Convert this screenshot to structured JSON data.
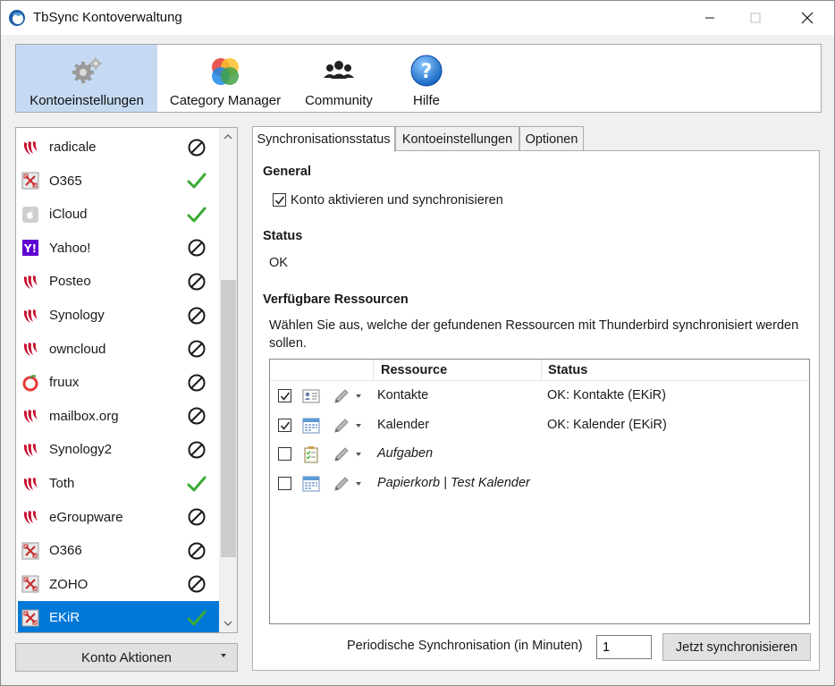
{
  "window": {
    "title": "TbSync Kontoverwaltung"
  },
  "toolbar": {
    "items": [
      {
        "label": "Kontoeinstellungen",
        "icon": "gears-icon",
        "active": true
      },
      {
        "label": "Category Manager",
        "icon": "color-circles-icon",
        "active": false
      },
      {
        "label": "Community",
        "icon": "people-icon",
        "active": false
      },
      {
        "label": "Hilfe",
        "icon": "help-icon",
        "active": false
      }
    ]
  },
  "accounts": {
    "items": [
      {
        "name": "radicale",
        "icon": "caldav-icon",
        "status": "disabled"
      },
      {
        "name": "O365",
        "icon": "eas-icon",
        "status": "ok"
      },
      {
        "name": "iCloud",
        "icon": "icloud-icon",
        "status": "ok"
      },
      {
        "name": "Yahoo!",
        "icon": "yahoo-icon",
        "status": "disabled"
      },
      {
        "name": "Posteo",
        "icon": "caldav-icon",
        "status": "disabled"
      },
      {
        "name": "Synology",
        "icon": "caldav-icon",
        "status": "disabled"
      },
      {
        "name": "owncloud",
        "icon": "caldav-icon",
        "status": "disabled"
      },
      {
        "name": "fruux",
        "icon": "fruux-icon",
        "status": "disabled"
      },
      {
        "name": "mailbox.org",
        "icon": "caldav-icon",
        "status": "disabled"
      },
      {
        "name": "Synology2",
        "icon": "caldav-icon",
        "status": "disabled"
      },
      {
        "name": "Toth",
        "icon": "caldav-icon",
        "status": "ok"
      },
      {
        "name": "eGroupware",
        "icon": "caldav-icon",
        "status": "disabled"
      },
      {
        "name": "O366",
        "icon": "eas-icon",
        "status": "disabled"
      },
      {
        "name": "ZOHO",
        "icon": "eas-icon",
        "status": "disabled"
      },
      {
        "name": "EKiR",
        "icon": "eas-icon",
        "status": "ok",
        "selected": true
      }
    ],
    "actions_label": "Konto Aktionen"
  },
  "tabs": {
    "sync": "Synchronisationsstatus",
    "konto": "Kontoeinstellungen",
    "optionen": "Optionen"
  },
  "panel": {
    "general_title": "General",
    "enable_label": "Konto aktivieren und synchronisieren",
    "enable_checked": true,
    "status_title": "Status",
    "status_value": "OK",
    "resources_title": "Verfügbare Ressourcen",
    "resources_desc_line1": "Wählen Sie aus, welche der gefundenen Ressourcen mit Thunderbird synchronisiert werden",
    "resources_desc_line2": "sollen.",
    "col_resource": "Ressource",
    "col_status": "Status",
    "resources": [
      {
        "name": "Kontakte",
        "status": "OK: Kontakte (EKiR)",
        "checked": true,
        "icon": "contacts-icon",
        "italic": false
      },
      {
        "name": "Kalender",
        "status": "OK: Kalender (EKiR)",
        "checked": true,
        "icon": "calendar-icon",
        "italic": false
      },
      {
        "name": "Aufgaben",
        "status": "",
        "checked": false,
        "icon": "tasks-icon",
        "italic": true
      },
      {
        "name": "Papierkorb | Test Kalender",
        "status": "",
        "checked": false,
        "icon": "calendar-icon",
        "italic": true
      }
    ],
    "periodic_label": "Periodische Synchronisation (in Minuten)",
    "periodic_value": "1",
    "sync_now_label": "Jetzt synchronisieren"
  },
  "colors": {
    "selection": "#0078d7",
    "toolbar_active": "#c5daf2",
    "ok_green": "#3aaa35",
    "caldav_red": "#c8102e"
  }
}
